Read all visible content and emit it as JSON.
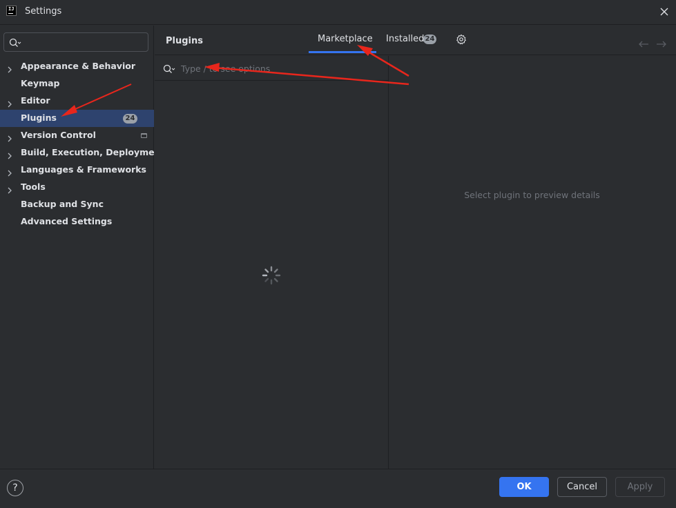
{
  "window": {
    "title": "Settings",
    "app_icon_text": "IJ"
  },
  "sidebar": {
    "search_placeholder": "",
    "items": [
      {
        "label": "Appearance & Behavior",
        "expandable": true
      },
      {
        "label": "Keymap",
        "expandable": false
      },
      {
        "label": "Editor",
        "expandable": true
      },
      {
        "label": "Plugins",
        "expandable": false,
        "selected": true,
        "count": "24"
      },
      {
        "label": "Version Control",
        "expandable": true
      },
      {
        "label": "Build, Execution, Deployment",
        "expandable": true
      },
      {
        "label": "Languages & Frameworks",
        "expandable": true
      },
      {
        "label": "Tools",
        "expandable": true
      },
      {
        "label": "Backup and Sync",
        "expandable": false
      },
      {
        "label": "Advanced Settings",
        "expandable": false
      }
    ]
  },
  "header": {
    "title": "Plugins",
    "tabs": [
      {
        "label": "Marketplace",
        "active": true
      },
      {
        "label": "Installed",
        "count": "24"
      }
    ]
  },
  "list": {
    "search_placeholder": "Type / to see options"
  },
  "detail": {
    "empty_message": "Select plugin to preview details"
  },
  "footer": {
    "help": "?",
    "ok": "OK",
    "cancel": "Cancel",
    "apply": "Apply"
  },
  "colors": {
    "accent": "#3574f0",
    "selection": "#2e436e",
    "annotation": "#e8261c",
    "background": "#2b2d30"
  }
}
